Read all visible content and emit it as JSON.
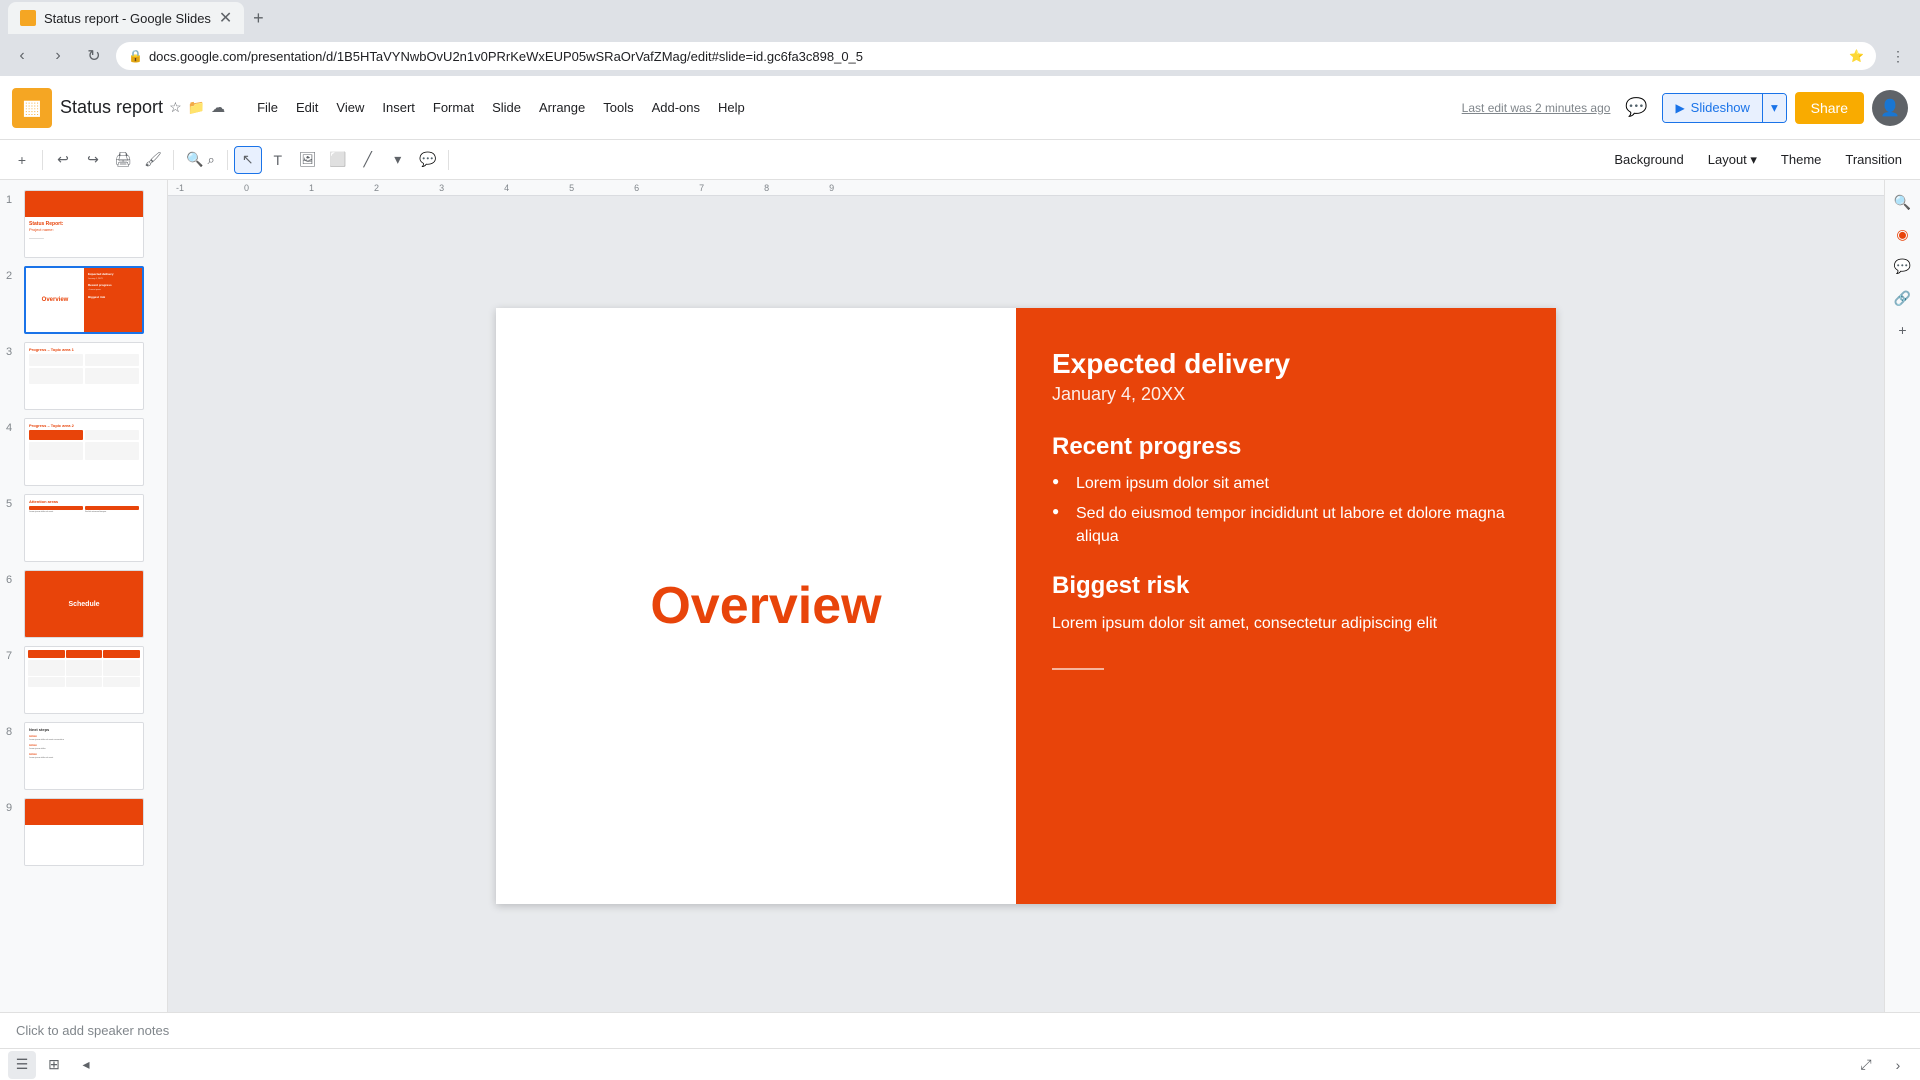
{
  "browser": {
    "tab_title": "Status report - Google Slides",
    "url": "docs.google.com/presentation/d/1B5HTaVYNwbOvU2n1v0PRrKeWxEUP05wSRaOrVafZMag/edit#slide=id.gc6fa3c898_0_5",
    "favicon": "📊"
  },
  "app": {
    "logo": "📊",
    "title": "Status report",
    "last_edit": "Last edit was 2 minutes ago",
    "menus": [
      "File",
      "Edit",
      "View",
      "Insert",
      "Format",
      "Slide",
      "Arrange",
      "Tools",
      "Add-ons",
      "Help"
    ],
    "toolbar_actions": [
      "Background",
      "Layout",
      "Theme",
      "Transition"
    ],
    "slideshow_btn": "Slideshow",
    "share_btn": "Share"
  },
  "slide_panel": {
    "slides": [
      {
        "num": "1"
      },
      {
        "num": "2"
      },
      {
        "num": "3"
      },
      {
        "num": "4"
      },
      {
        "num": "5"
      },
      {
        "num": "6"
      },
      {
        "num": "7"
      },
      {
        "num": "8"
      },
      {
        "num": "9"
      }
    ]
  },
  "current_slide": {
    "title": "Overview",
    "delivery_heading": "Expected delivery",
    "delivery_date": "January 4, 20XX",
    "progress_heading": "Recent progress",
    "progress_items": [
      "Lorem ipsum dolor sit amet",
      "Sed do eiusmod tempor incididunt ut labore et dolore magna aliqua"
    ],
    "risk_heading": "Biggest risk",
    "risk_text": "Lorem ipsum dolor sit amet, consectetur adipiscing elit"
  },
  "notes": {
    "placeholder": "Click to add speaker notes"
  },
  "zoom": {
    "level": "Fit"
  }
}
